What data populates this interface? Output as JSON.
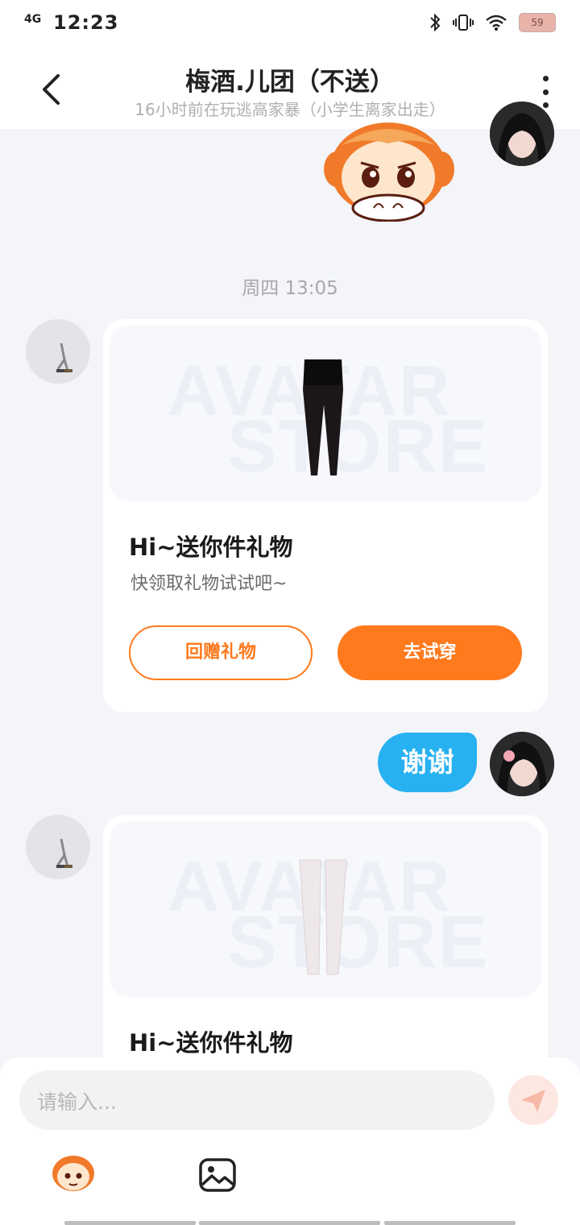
{
  "status_bar": {
    "network": "4G",
    "time": "12:23",
    "battery": "59"
  },
  "header": {
    "title": "梅酒.儿团（不送）",
    "subtitle": "16小时前在玩逃高家暴（小学生离家出走）"
  },
  "chat": {
    "timestamp": "周四 13:05",
    "cards": [
      {
        "watermark_line1": "AVATAR",
        "watermark_line2": "STORE",
        "title": "Hi~送你件礼物",
        "desc": "快领取礼物试试吧~",
        "btn_return": "回赠礼物",
        "btn_try": "去试穿",
        "item": "black-tights"
      },
      {
        "watermark_line1": "AVATAR",
        "watermark_line2": "STORE",
        "title": "Hi~送你件礼物",
        "item": "white-stockings"
      }
    ],
    "my_message": "谢谢"
  },
  "input": {
    "placeholder": "请输入..."
  },
  "colors": {
    "accent": "#ff7a1d",
    "bubble": "#27b1f0",
    "background": "#f3f5f9"
  }
}
